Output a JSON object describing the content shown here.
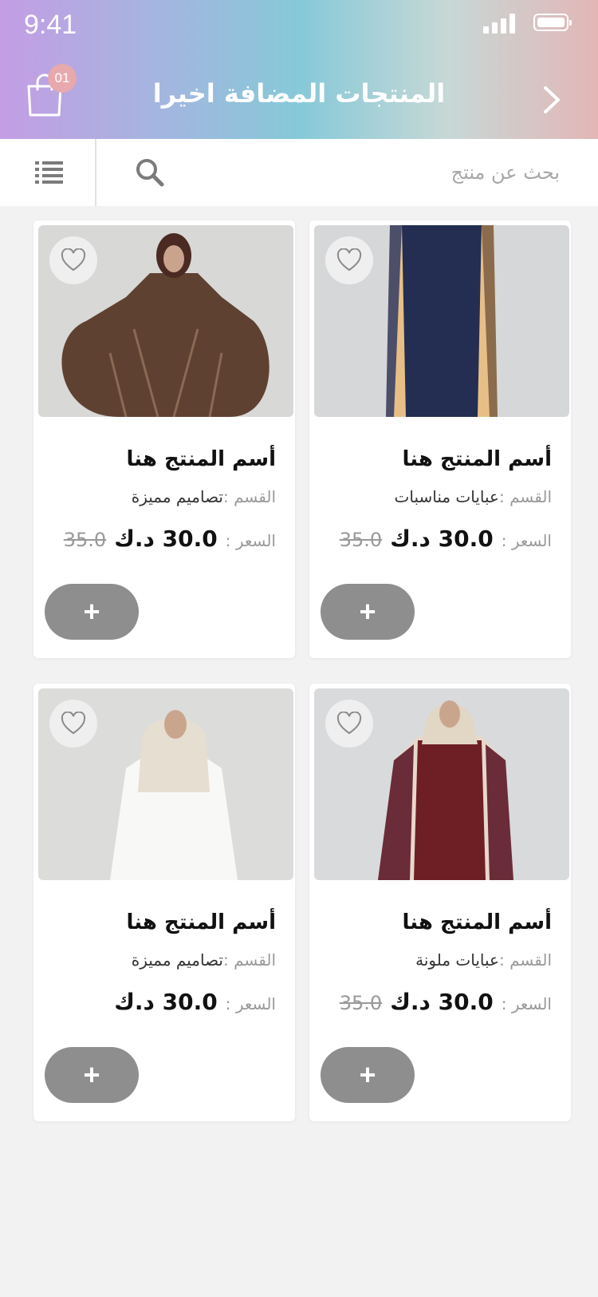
{
  "status_bar": {
    "time": "9:41"
  },
  "header": {
    "title": "المنتجات المضافة اخيرا",
    "cart_count": "01"
  },
  "search": {
    "placeholder": "بحث عن منتج"
  },
  "labels": {
    "category": "القسم :",
    "price": "السعر :"
  },
  "colors": {
    "add_button": "#8e8e8e",
    "badge": "#e7a9ad"
  },
  "products": [
    {
      "name": "أسم المنتج هنا",
      "category": "تصاميم مميزة",
      "price": "30.0 د.ك",
      "old_price": "35.0",
      "image": "brown-patterned-abaya"
    },
    {
      "name": "أسم المنتج هنا",
      "category": "عبايات مناسبات",
      "price": "30.0 د.ك",
      "old_price": "35.0",
      "image": "navy-beige-abaya"
    },
    {
      "name": "أسم المنتج هنا",
      "category": "تصاميم مميزة",
      "price": "30.0 د.ك",
      "old_price": "",
      "image": "white-lace-abaya"
    },
    {
      "name": "أسم المنتج هنا",
      "category": "عبايات ملونة",
      "price": "30.0 د.ك",
      "old_price": "35.0",
      "image": "maroon-floral-abaya"
    }
  ],
  "add_label": "+"
}
